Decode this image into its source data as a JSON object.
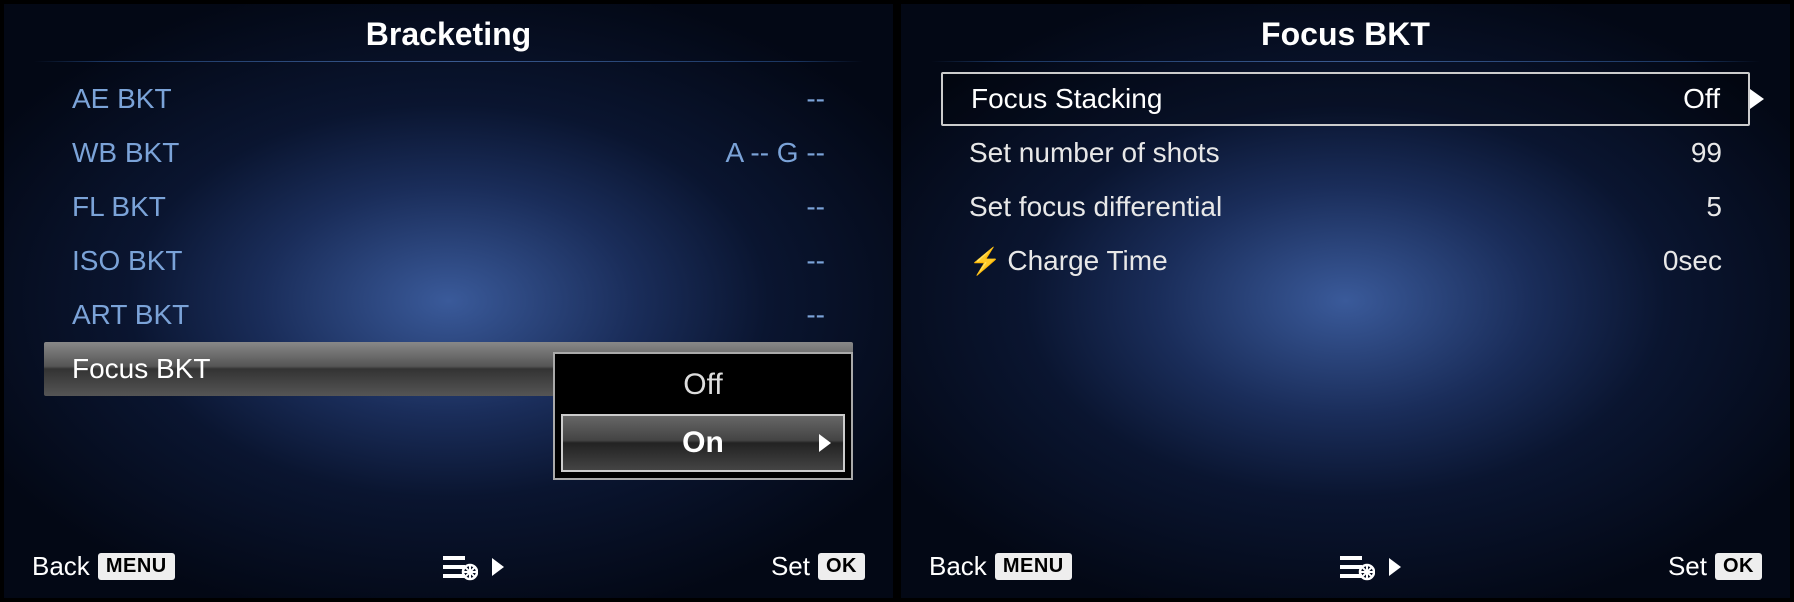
{
  "left": {
    "title": "Bracketing",
    "items": [
      {
        "label": "AE BKT",
        "value": "--"
      },
      {
        "label": "WB BKT",
        "value": "A --  G --"
      },
      {
        "label": "FL BKT",
        "value": "--"
      },
      {
        "label": "ISO BKT",
        "value": "--"
      },
      {
        "label": "ART BKT",
        "value": "--"
      },
      {
        "label": "Focus BKT",
        "value": ""
      }
    ],
    "submenu": {
      "options": [
        "Off",
        "On"
      ]
    },
    "footer": {
      "back": "Back",
      "menuBadge": "MENU",
      "set": "Set",
      "okBadge": "OK"
    }
  },
  "right": {
    "title": "Focus BKT",
    "items": [
      {
        "label": "Focus Stacking",
        "value": "Off"
      },
      {
        "label": "Set number of shots",
        "value": "99"
      },
      {
        "label": "Set focus differential",
        "value": "5"
      },
      {
        "label": "Charge Time",
        "value": "0sec",
        "hasFlash": true
      }
    ],
    "footer": {
      "back": "Back",
      "menuBadge": "MENU",
      "set": "Set",
      "okBadge": "OK"
    }
  }
}
